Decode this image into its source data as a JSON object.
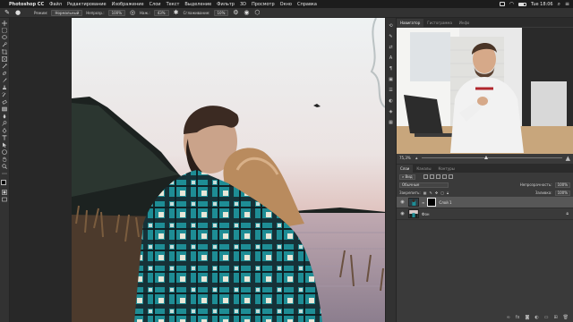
{
  "menubar": {
    "app": "Photoshop CC",
    "items": [
      "Файл",
      "Редактирование",
      "Изображение",
      "Слои",
      "Текст",
      "Выделение",
      "Фильтр",
      "3D",
      "Просмотр",
      "Окно",
      "Справка"
    ],
    "clock": "Tue 18:06"
  },
  "options": {
    "mode_label": "Режим:",
    "mode_value": "Нормальный",
    "opacity_label": "Непрозр.:",
    "opacity_value": "100%",
    "flow_label": "Наж.:",
    "flow_value": "43%",
    "smoothing_label": "Сглаживание:",
    "smoothing_value": "10%"
  },
  "navigator": {
    "tabs": [
      "Навигатор",
      "Гистограмма",
      "Инфо"
    ],
    "zoom": "75,3%"
  },
  "layers": {
    "tabs": [
      "Слои",
      "Каналы",
      "Контуры"
    ],
    "filter_label": "Вид",
    "blend": "Обычные",
    "opacity_label": "Непрозрачность:",
    "opacity_value": "100%",
    "lock_label": "Закрепить:",
    "fill_label": "Заливка:",
    "fill_value": "100%",
    "items": [
      {
        "name": "Слой 1",
        "active": true
      },
      {
        "name": "Фон",
        "active": false
      }
    ]
  },
  "colors": {
    "accent": "#3a86ff",
    "panel": "#3a3a3a",
    "toolbar": "#323232"
  }
}
